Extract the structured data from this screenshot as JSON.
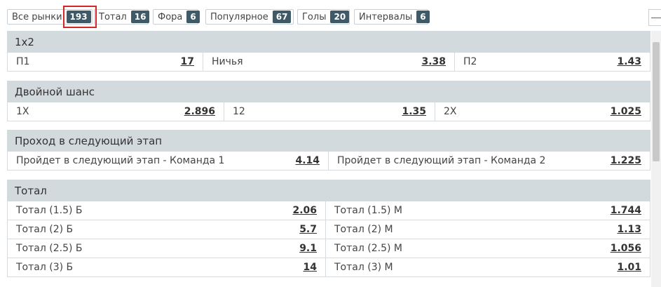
{
  "tabs": [
    {
      "label": "Все рынки",
      "count": "193"
    },
    {
      "label": "Тотал",
      "count": "16"
    },
    {
      "label": "Фора",
      "count": "6"
    },
    {
      "label": "Популярное",
      "count": "67"
    },
    {
      "label": "Голы",
      "count": "20"
    },
    {
      "label": "Интервалы",
      "count": "6"
    }
  ],
  "markets": [
    {
      "title": "1x2",
      "rows": [
        [
          {
            "label": "П1",
            "odd": "17"
          },
          {
            "label": "Ничья",
            "odd": "3.38"
          },
          {
            "label": "П2",
            "odd": "1.43"
          }
        ]
      ]
    },
    {
      "title": "Двойной шанс",
      "rows": [
        [
          {
            "label": "1X",
            "odd": "2.896"
          },
          {
            "label": "12",
            "odd": "1.35"
          },
          {
            "label": "2X",
            "odd": "1.025"
          }
        ]
      ]
    },
    {
      "title": "Проход в следующий этап",
      "rows": [
        [
          {
            "label": "Пройдет в следующий этап - Команда 1",
            "odd": "4.14"
          },
          {
            "label": "Пройдет в следующий этап - Команда 2",
            "odd": "1.225"
          }
        ]
      ]
    },
    {
      "title": "Тотал",
      "rows": [
        [
          {
            "label": "Тотал (1.5) Б",
            "odd": "2.06"
          },
          {
            "label": "Тотал (1.5) М",
            "odd": "1.744"
          }
        ],
        [
          {
            "label": "Тотал (2) Б",
            "odd": "5.7"
          },
          {
            "label": "Тотал (2) М",
            "odd": "1.13"
          }
        ],
        [
          {
            "label": "Тотал (2.5) Б",
            "odd": "9.1"
          },
          {
            "label": "Тотал (2.5) М",
            "odd": "1.056"
          }
        ],
        [
          {
            "label": "Тотал (3) Б",
            "odd": "14"
          },
          {
            "label": "Тотал (3) М",
            "odd": "1.01"
          }
        ]
      ]
    }
  ]
}
